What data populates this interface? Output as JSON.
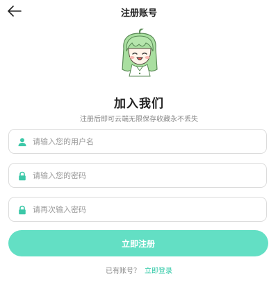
{
  "header": {
    "title": "注册账号",
    "back_icon": "arrow-left-icon"
  },
  "mascot": {
    "icon": "anime-girl-avatar"
  },
  "intro": {
    "heading": "加入我们",
    "subheading": "注册后即可云端无限保存收藏永不丢失"
  },
  "form": {
    "username": {
      "placeholder": "请输入您的用户名",
      "value": "",
      "icon": "user-icon"
    },
    "password": {
      "placeholder": "请输入您的密码",
      "value": "",
      "icon": "lock-icon"
    },
    "confirm_password": {
      "placeholder": "请再次输入密码",
      "value": "",
      "icon": "lock-icon"
    },
    "submit_label": "立即注册"
  },
  "footer": {
    "question": "已有账号？",
    "login_link": "立即登录"
  },
  "colors": {
    "accent": "#63dfc4",
    "link": "#2ec8a6",
    "icon": "#3cc8a8"
  }
}
